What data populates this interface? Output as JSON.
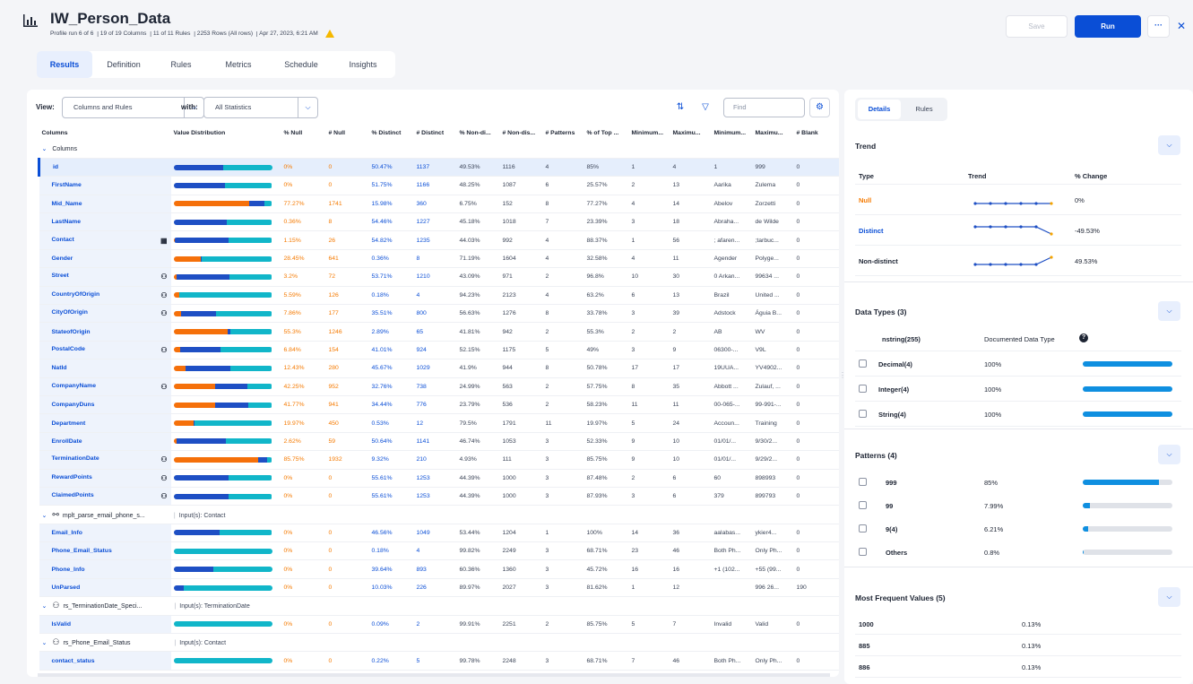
{
  "header": {
    "title": "IW_Person_Data",
    "meta": [
      "Profile run 6 of 6",
      "19 of 19 Columns",
      "11 of 11 Rules",
      "2253 Rows (All rows)",
      "Apr 27, 2023, 6:21 AM"
    ],
    "save_label": "Save",
    "run_label": "Run",
    "more_label": "···",
    "close_label": "✕"
  },
  "tabs": [
    "Results",
    "Definition",
    "Rules",
    "Metrics",
    "Schedule",
    "Insights"
  ],
  "viewbar": {
    "view_label": "View:",
    "view_value": "Columns and Rules",
    "with_label": "with:",
    "with_value": "All Statistics",
    "find_placeholder": "Find"
  },
  "table": {
    "headers": [
      "Columns",
      "Value Distribution",
      "% Null",
      "# Null",
      "% Distinct",
      "# Distinct",
      "% Non-di...",
      "# Non-dis...",
      "# Patterns",
      "% of Top ...",
      "Minimum...",
      "Maximu...",
      "Minimum...",
      "Maximu...",
      "# Blank"
    ],
    "group_columns": "Columns",
    "rows": [
      {
        "name": "id",
        "dist": [
          0,
          50,
          50
        ],
        "pn": "0%",
        "nn": "0",
        "pd": "50.47%",
        "nd": "1137",
        "pnd": "49.53%",
        "nnd": "1116",
        "pat": "4",
        "top": "85%",
        "min1": "1",
        "max1": "4",
        "min2": "1",
        "max2": "999",
        "blank": "0",
        "sel": true
      },
      {
        "name": "FirstName",
        "dist": [
          0,
          52,
          48
        ],
        "pn": "0%",
        "nn": "0",
        "pd": "51.75%",
        "nd": "1166",
        "pnd": "48.25%",
        "nnd": "1087",
        "pat": "6",
        "top": "25.57%",
        "min1": "2",
        "max1": "13",
        "min2": "Aarika",
        "max2": "Zulema",
        "blank": "0"
      },
      {
        "name": "Mid_Name",
        "dist": [
          77,
          15,
          8
        ],
        "pn": "77.27%",
        "nn": "1741",
        "pd": "15.98%",
        "nd": "360",
        "pnd": "6.75%",
        "nnd": "152",
        "pat": "8",
        "top": "77.27%",
        "min1": "4",
        "max1": "14",
        "min2": "Abelov",
        "max2": "Zorzetti",
        "blank": "0"
      },
      {
        "name": "LastName",
        "dist": [
          0,
          54,
          46
        ],
        "pn": "0.36%",
        "nn": "8",
        "pd": "54.46%",
        "nd": "1227",
        "pnd": "45.18%",
        "nnd": "1018",
        "pat": "7",
        "top": "23.39%",
        "min1": "3",
        "max1": "18",
        "min2": "Abraha...",
        "max2": "de Wilde",
        "blank": "0"
      },
      {
        "name": "Contact",
        "dist": [
          1,
          55,
          44
        ],
        "pn": "1.15%",
        "nn": "26",
        "pd": "54.82%",
        "nd": "1235",
        "pnd": "44.03%",
        "nnd": "992",
        "pat": "4",
        "top": "88.37%",
        "min1": "1",
        "max1": "56",
        "min2": "; afaren...",
        "max2": ";tarbuc...",
        "blank": "0",
        "tag": "▦"
      },
      {
        "name": "Gender",
        "dist": [
          28,
          1,
          71
        ],
        "pn": "28.45%",
        "nn": "641",
        "pd": "0.36%",
        "nd": "8",
        "pnd": "71.19%",
        "nnd": "1604",
        "pat": "4",
        "top": "32.58%",
        "min1": "4",
        "max1": "11",
        "min2": "Agender",
        "max2": "Polyge...",
        "blank": "0"
      },
      {
        "name": "Street",
        "dist": [
          3,
          54,
          43
        ],
        "pn": "3.2%",
        "nn": "72",
        "pd": "53.71%",
        "nd": "1210",
        "pnd": "43.09%",
        "nnd": "971",
        "pat": "2",
        "top": "96.8%",
        "min1": "10",
        "max1": "30",
        "min2": "0 Arkan...",
        "max2": "99634 ...",
        "blank": "0",
        "tag": "⚇"
      },
      {
        "name": "CountryOfOrigin",
        "dist": [
          6,
          0,
          94
        ],
        "pn": "5.59%",
        "nn": "126",
        "pd": "0.18%",
        "nd": "4",
        "pnd": "94.23%",
        "nnd": "2123",
        "pat": "4",
        "top": "63.2%",
        "min1": "6",
        "max1": "13",
        "min2": "Brazil",
        "max2": "United ...",
        "blank": "0",
        "tag": "⚇"
      },
      {
        "name": "CityOfOrigin",
        "dist": [
          8,
          35,
          57
        ],
        "pn": "7.86%",
        "nn": "177",
        "pd": "35.51%",
        "nd": "800",
        "pnd": "56.63%",
        "nnd": "1276",
        "pat": "8",
        "top": "33.78%",
        "min1": "3",
        "max1": "39",
        "min2": "Adstock",
        "max2": "Águia B...",
        "blank": "0",
        "tag": "⚇"
      },
      {
        "name": "StateofOrigin",
        "dist": [
          55,
          3,
          42
        ],
        "pn": "55.3%",
        "nn": "1246",
        "pd": "2.89%",
        "nd": "65",
        "pnd": "41.81%",
        "nnd": "942",
        "pat": "2",
        "top": "55.3%",
        "min1": "2",
        "max1": "2",
        "min2": "AB",
        "max2": "WV",
        "blank": "0"
      },
      {
        "name": "PostalCode",
        "dist": [
          7,
          41,
          52
        ],
        "pn": "6.84%",
        "nn": "154",
        "pd": "41.01%",
        "nd": "924",
        "pnd": "52.15%",
        "nnd": "1175",
        "pat": "5",
        "top": "49%",
        "min1": "3",
        "max1": "9",
        "min2": "06300-...",
        "max2": "V9L",
        "blank": "0",
        "tag": "⚇"
      },
      {
        "name": "NatId",
        "dist": [
          12,
          46,
          42
        ],
        "pn": "12.43%",
        "nn": "280",
        "pd": "45.67%",
        "nd": "1029",
        "pnd": "41.9%",
        "nnd": "944",
        "pat": "8",
        "top": "50.78%",
        "min1": "17",
        "max1": "17",
        "min2": "19UUA...",
        "max2": "YV4902...",
        "blank": "0"
      },
      {
        "name": "CompanyName",
        "dist": [
          42,
          33,
          25
        ],
        "pn": "42.25%",
        "nn": "952",
        "pd": "32.76%",
        "nd": "738",
        "pnd": "24.99%",
        "nnd": "563",
        "pat": "2",
        "top": "57.75%",
        "min1": "8",
        "max1": "35",
        "min2": "Abbott ...",
        "max2": "Zulauf, ...",
        "blank": "0",
        "tag": "⚇"
      },
      {
        "name": "CompanyDuns",
        "dist": [
          42,
          34,
          24
        ],
        "pn": "41.77%",
        "nn": "941",
        "pd": "34.44%",
        "nd": "776",
        "pnd": "23.79%",
        "nnd": "536",
        "pat": "2",
        "top": "58.23%",
        "min1": "11",
        "max1": "11",
        "min2": "00-065-...",
        "max2": "99-991-...",
        "blank": "0"
      },
      {
        "name": "Department",
        "dist": [
          20,
          1,
          79
        ],
        "pn": "19.97%",
        "nn": "450",
        "pd": "0.53%",
        "nd": "12",
        "pnd": "79.5%",
        "nnd": "1791",
        "pat": "11",
        "top": "19.97%",
        "min1": "5",
        "max1": "24",
        "min2": "Accoun...",
        "max2": "Training",
        "blank": "0"
      },
      {
        "name": "EnrollDate",
        "dist": [
          3,
          50,
          47
        ],
        "pn": "2.62%",
        "nn": "59",
        "pd": "50.64%",
        "nd": "1141",
        "pnd": "46.74%",
        "nnd": "1053",
        "pat": "3",
        "top": "52.33%",
        "min1": "9",
        "max1": "10",
        "min2": "01/01/...",
        "max2": "9/30/2...",
        "blank": "0"
      },
      {
        "name": "TerminationDate",
        "dist": [
          86,
          9,
          5
        ],
        "pn": "85.75%",
        "nn": "1932",
        "pd": "9.32%",
        "nd": "210",
        "pnd": "4.93%",
        "nnd": "111",
        "pat": "3",
        "top": "85.75%",
        "min1": "9",
        "max1": "10",
        "min2": "01/01/...",
        "max2": "9/29/2...",
        "blank": "0",
        "tag": "⚇"
      },
      {
        "name": "RewardPoints",
        "dist": [
          0,
          56,
          44
        ],
        "pn": "0%",
        "nn": "0",
        "pd": "55.61%",
        "nd": "1253",
        "pnd": "44.39%",
        "nnd": "1000",
        "pat": "3",
        "top": "87.48%",
        "min1": "2",
        "max1": "6",
        "min2": "60",
        "max2": "898993",
        "blank": "0",
        "tag": "⚇"
      },
      {
        "name": "ClaimedPoints",
        "dist": [
          0,
          56,
          44
        ],
        "pn": "0%",
        "nn": "0",
        "pd": "55.61%",
        "nd": "1253",
        "pnd": "44.39%",
        "nnd": "1000",
        "pat": "3",
        "top": "87.93%",
        "min1": "3",
        "max1": "6",
        "min2": "379",
        "max2": "899793",
        "blank": "0",
        "tag": "⚇"
      }
    ],
    "group_parse": {
      "name": "mplt_parse_email_phone_s...",
      "inputs": "Input(s): Contact"
    },
    "parse_rows": [
      {
        "name": "Email_Info",
        "dist": [
          0,
          47,
          53
        ],
        "pn": "0%",
        "nn": "0",
        "pd": "46.56%",
        "nd": "1049",
        "pnd": "53.44%",
        "nnd": "1204",
        "pat": "1",
        "top": "100%",
        "min1": "14",
        "max1": "36",
        "min2": "aalabas...",
        "max2": "ykier4...",
        "blank": "0"
      },
      {
        "name": "Phone_Email_Status",
        "dist": [
          0,
          0,
          100
        ],
        "pn": "0%",
        "nn": "0",
        "pd": "0.18%",
        "nd": "4",
        "pnd": "99.82%",
        "nnd": "2249",
        "pat": "3",
        "top": "68.71%",
        "min1": "23",
        "max1": "46",
        "min2": "Both Ph...",
        "max2": "Only Ph...",
        "blank": "0"
      },
      {
        "name": "Phone_Info",
        "dist": [
          0,
          40,
          60
        ],
        "pn": "0%",
        "nn": "0",
        "pd": "39.64%",
        "nd": "893",
        "pnd": "60.36%",
        "nnd": "1360",
        "pat": "3",
        "top": "45.72%",
        "min1": "16",
        "max1": "16",
        "min2": "+1 (102...",
        "max2": "+55 (99...",
        "blank": "0"
      },
      {
        "name": "UnParsed",
        "dist": [
          0,
          10,
          90
        ],
        "pn": "0%",
        "nn": "0",
        "pd": "10.03%",
        "nd": "226",
        "pnd": "89.97%",
        "nnd": "2027",
        "pat": "3",
        "top": "81.62%",
        "min1": "1",
        "max1": "12",
        "min2": "",
        "max2": "996 26...",
        "blank": "190"
      }
    ],
    "group_term": {
      "name": "rs_TerminationDate_Speci...",
      "inputs": "Input(s): TerminationDate"
    },
    "term_rows": [
      {
        "name": "IsValid",
        "dist": [
          0,
          0,
          100
        ],
        "pn": "0%",
        "nn": "0",
        "pd": "0.09%",
        "nd": "2",
        "pnd": "99.91%",
        "nnd": "2251",
        "pat": "2",
        "top": "85.75%",
        "min1": "5",
        "max1": "7",
        "min2": "Invalid",
        "max2": "Valid",
        "blank": "0"
      }
    ],
    "group_phone": {
      "name": "rs_Phone_Email_Status",
      "inputs": "Input(s): Contact"
    },
    "phone_rows": [
      {
        "name": "contact_status",
        "dist": [
          0,
          0,
          100
        ],
        "pn": "0%",
        "nn": "0",
        "pd": "0.22%",
        "nd": "5",
        "pnd": "99.78%",
        "nnd": "2248",
        "pat": "3",
        "top": "68.71%",
        "min1": "7",
        "max1": "46",
        "min2": "Both Ph...",
        "max2": "Only Ph...",
        "blank": "0"
      }
    ]
  },
  "details": {
    "tabs": [
      "Details",
      "Rules"
    ],
    "trend": {
      "title": "Trend",
      "headers": [
        "Type",
        "Trend",
        "% Change"
      ],
      "rows": [
        {
          "type": "Null",
          "change": "0%",
          "color": "#f57a00",
          "values": [
            0,
            0,
            0,
            0,
            0,
            0
          ]
        },
        {
          "type": "Distinct",
          "change": "-49.53%",
          "color": "#0a4ed6",
          "values": [
            1,
            1,
            1,
            1,
            1,
            0
          ]
        },
        {
          "type": "Non-distinct",
          "change": "49.53%",
          "color": "#1d2433",
          "values": [
            0,
            0,
            0,
            0,
            0,
            1
          ]
        }
      ]
    },
    "datatypes": {
      "title": "Data Types (3)",
      "header_left": "nstring(255)",
      "header_right": "Documented Data Type",
      "rows": [
        {
          "label": "Decimal(4)",
          "pct": "100%",
          "value": 100
        },
        {
          "label": "Integer(4)",
          "pct": "100%",
          "value": 100
        },
        {
          "label": "String(4)",
          "pct": "100%",
          "value": 100
        }
      ]
    },
    "patterns": {
      "title": "Patterns (4)",
      "rows": [
        {
          "label": "999",
          "pct": "85%",
          "value": 85
        },
        {
          "label": "99",
          "pct": "7.99%",
          "value": 8
        },
        {
          "label": "9(4)",
          "pct": "6.21%",
          "value": 6
        },
        {
          "label": "Others",
          "pct": "0.8%",
          "value": 1
        }
      ]
    },
    "frequent": {
      "title": "Most Frequent Values (5)",
      "rows": [
        {
          "label": "1000",
          "pct": "0.13%"
        },
        {
          "label": "885",
          "pct": "0.13%"
        },
        {
          "label": "886",
          "pct": "0.13%"
        }
      ]
    }
  }
}
